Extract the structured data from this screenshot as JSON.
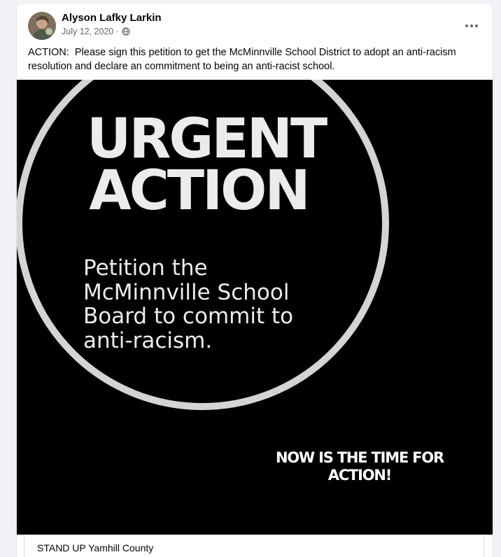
{
  "post": {
    "author": "Alyson Lafky Larkin",
    "date": "July 12, 2020",
    "separator": "·",
    "audience_icon": "public-globe-icon",
    "more_label": "•••",
    "text": "ACTION:  Please sign this petition to get the McMinnville School District to adopt an anti-racism resolution and declare an commitment to being an anti-racist school."
  },
  "image": {
    "headline_line1": "URGENT",
    "headline_line2": "ACTION",
    "body": "Petition the\nMcMinnville School\nBoard to commit to\nanti-racism.",
    "footer": "NOW IS THE TIME FOR\nACTION!",
    "ring_color": "#d4d4d4",
    "background_color": "#000000"
  },
  "link_preview": {
    "title": "STAND UP Yamhill County"
  }
}
